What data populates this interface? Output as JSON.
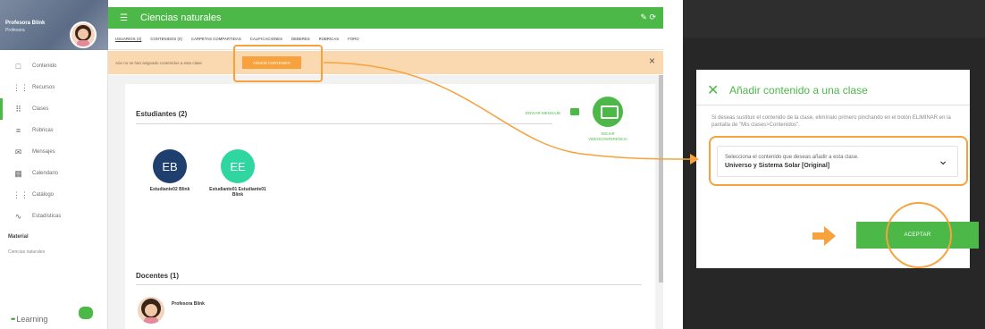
{
  "app": {
    "title": "Ciencias naturales",
    "profile": {
      "name": "Profesora Blink",
      "subtitle": "Profesora"
    },
    "sidebar": {
      "items": [
        {
          "label": "Contenido",
          "icon": "□"
        },
        {
          "label": "Recursos",
          "icon": "⋮⋮"
        },
        {
          "label": "Clases",
          "icon": "⠿"
        },
        {
          "label": "Rúbricas",
          "icon": "≡"
        },
        {
          "label": "Mensajes",
          "icon": "✉"
        },
        {
          "label": "Calendario",
          "icon": "▦"
        },
        {
          "label": "Catálogo",
          "icon": "⋮⋮"
        },
        {
          "label": "Estadísticas",
          "icon": "∿"
        }
      ],
      "section_title": "Material",
      "section_item": "Ciencias naturales",
      "brand": "Learning"
    },
    "tabs": [
      "USUARIOS (3)",
      "CONTENIDOS (0)",
      "CARPETAS COMPARTIDAS",
      "CALIFICACIONES",
      "DEBERES",
      "RÚBRICAS",
      "FORO"
    ],
    "banner": {
      "text": "Aún no se han asignado contenidos a esta clase",
      "button": "AÑADIR CONTENIDO",
      "close": "×"
    },
    "students": {
      "title": "Estudiantes (2)",
      "send_message": "ENVIAR MENSAJE",
      "videoconf": "INICIAR VIDEOCONFERENCIA",
      "list": [
        {
          "initials": "EB",
          "name": "Estudiante02 Blink",
          "color": "#1f3f6e"
        },
        {
          "initials": "EE",
          "name": "Estudiante01 Estudiante01 Blink",
          "color": "#2fd6a0"
        }
      ]
    },
    "teachers": {
      "title": "Docentes (1)",
      "list": [
        {
          "name": "Profesora Blink"
        }
      ]
    }
  },
  "modal": {
    "title": "Añadir contenido a una clase",
    "description": "Si deseas sustituir el contenido de la clase, elimínalo primero pinchando en el botón ELIMINAR en la pantalla de \"Mis clases>Contenidos\".",
    "select_label": "Selecciona el contenido que deseas añadir a esta clase.",
    "select_value": "Universo y Sistema Solar [Original]",
    "accept": "ACEPTAR"
  },
  "colors": {
    "accent_green": "#4cb848",
    "highlight_orange": "#f7a23c",
    "banner_bg": "#fbd9b0",
    "dark_panel": "#272727"
  }
}
